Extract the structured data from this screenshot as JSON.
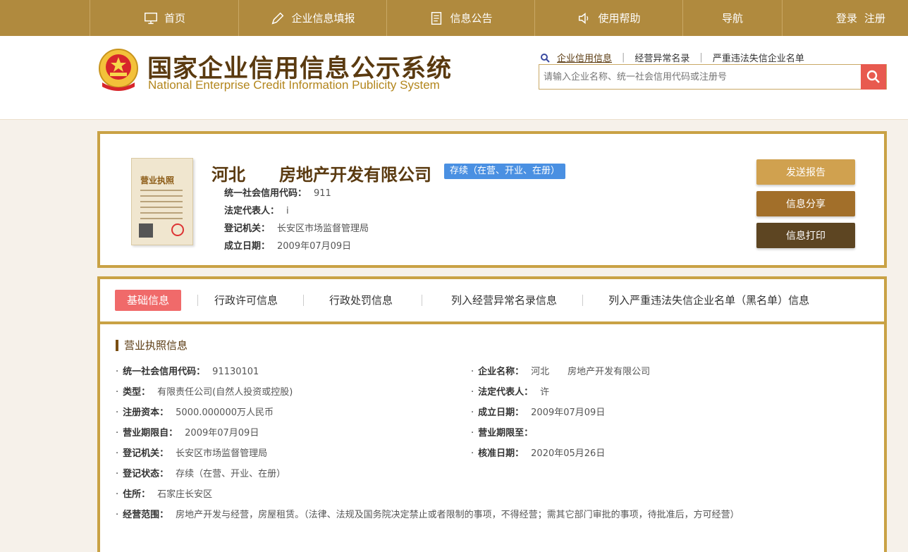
{
  "nav": {
    "items": [
      {
        "label": "首页",
        "icon": "monitor-icon"
      },
      {
        "label": "企业信息填报",
        "icon": "pen-icon"
      },
      {
        "label": "信息公告",
        "icon": "document-icon"
      },
      {
        "label": "使用帮助",
        "icon": "speaker-icon"
      },
      {
        "label": "导航",
        "icon": ""
      }
    ],
    "login": "登录",
    "register": "注册"
  },
  "header": {
    "title": "国家企业信用信息公示系统",
    "subtitle": "National Enterprise Credit Information Publicity System",
    "links": [
      "企业信用信息",
      "经营异常名录",
      "严重违法失信企业名单"
    ],
    "search_placeholder": "请输入企业名称、统一社会信用代码或注册号"
  },
  "company": {
    "name": "河北　　房地产开发有限公司",
    "status": "存续（在营、开业、在册）",
    "license_label": "营业执照",
    "info": [
      {
        "label": "统一社会信用代码：",
        "value": "911"
      },
      {
        "label": "法定代表人：",
        "value": "i"
      },
      {
        "label": "登记机关：",
        "value": "长安区市场监督管理局"
      },
      {
        "label": "成立日期：",
        "value": "2009年07月09日"
      }
    ],
    "buttons": {
      "send": "发送报告",
      "share": "信息分享",
      "print": "信息打印"
    }
  },
  "tabs": [
    "基础信息",
    "行政许可信息",
    "行政处罚信息",
    "列入经营异常名录信息",
    "列入严重违法失信企业名单（黑名单）信息"
  ],
  "section_title": "营业执照信息",
  "fields": {
    "credit_code": {
      "label": "统一社会信用代码：",
      "value": "91130101"
    },
    "company_name": {
      "label": "企业名称：",
      "value": "河北　　房地产开发有限公司"
    },
    "type": {
      "label": "类型：",
      "value": "有限责任公司(自然人投资或控股)"
    },
    "legal_rep": {
      "label": "法定代表人：",
      "value": "许"
    },
    "capital": {
      "label": "注册资本：",
      "value": "5000.000000万人民币"
    },
    "established": {
      "label": "成立日期：",
      "value": "2009年07月09日"
    },
    "term_from": {
      "label": "营业期限自：",
      "value": "2009年07月09日"
    },
    "term_to": {
      "label": "营业期限至：",
      "value": ""
    },
    "authority": {
      "label": "登记机关：",
      "value": "长安区市场监督管理局"
    },
    "approval_date": {
      "label": "核准日期：",
      "value": "2020年05月26日"
    },
    "reg_status": {
      "label": "登记状态：",
      "value": "存续（在营、开业、在册）"
    },
    "address": {
      "label": "住所：",
      "value": "石家庄长安区"
    },
    "scope": {
      "label": "经营范围：",
      "value": "房地产开发与经营，房屋租赁。（法律、法规及国务院决定禁止或者限制的事项，不得经营；需其它部门审批的事项，待批准后，方可经营）"
    }
  },
  "colors": {
    "gold": "#b08a3e",
    "border": "#c9a245",
    "brown": "#5a3a10",
    "badge": "#4a90e2",
    "active_tab": "#f06a6a",
    "search_btn": "#e85a4f"
  }
}
